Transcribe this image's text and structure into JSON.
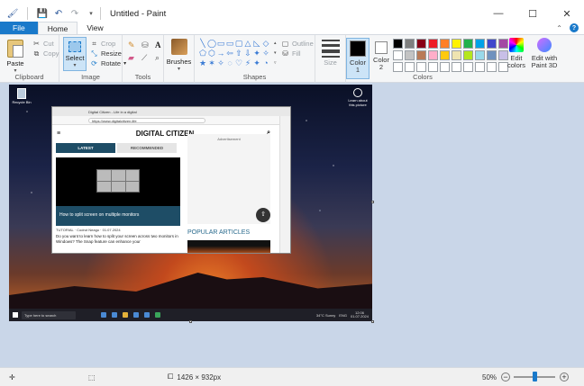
{
  "window": {
    "title": "Untitled - Paint"
  },
  "ribbon_tabs": [
    "File",
    "Home",
    "View"
  ],
  "clipboard": {
    "paste": "Paste",
    "cut": "Cut",
    "copy": "Copy",
    "label": "Clipboard"
  },
  "image": {
    "select": "Select",
    "crop": "Crop",
    "resize": "Resize",
    "rotate": "Rotate",
    "label": "Image"
  },
  "tools": {
    "label": "Tools"
  },
  "brushes": {
    "label": "Brushes"
  },
  "shapes": {
    "outline": "Outline",
    "fill": "Fill",
    "label": "Shapes",
    "glyphs": [
      "╲",
      "◯",
      "▭",
      "▭",
      "▢",
      "△",
      "◺",
      "◇",
      "⬠",
      "⬡",
      "→",
      "⇦",
      "⇧",
      "⇩",
      "✦",
      "✧",
      "★",
      "✶",
      "✧",
      "◌",
      "♡",
      "⚡",
      "✦",
      "◔"
    ]
  },
  "size": {
    "label": "Size"
  },
  "colors": {
    "color1_label": "Color\n1",
    "color2_label": "Color\n2",
    "label": "Colors",
    "color1": "#000000",
    "color2": "#ffffff",
    "palette": [
      "#000000",
      "#7f7f7f",
      "#880015",
      "#ed1c24",
      "#ff7f27",
      "#fff200",
      "#22b14c",
      "#00a2e8",
      "#3f48cc",
      "#a349a4",
      "#ffffff",
      "#c3c3c3",
      "#b97a57",
      "#ffaec9",
      "#ffc90e",
      "#efe4b0",
      "#b5e61d",
      "#99d9ea",
      "#7092be",
      "#c8bfe7",
      "#ffffff",
      "#ffffff",
      "#ffffff",
      "#ffffff",
      "#ffffff",
      "#ffffff",
      "#ffffff",
      "#ffffff",
      "#ffffff",
      "#ffffff"
    ],
    "edit_colors": "Edit\ncolors",
    "edit_3d": "Edit with\nPaint 3D"
  },
  "screenshot": {
    "recycle_bin": "Recycle Bin",
    "learn": "Learn about this picture",
    "browser_tab": "Digital Citizen - Life in a digital",
    "url": "https://www.digitalcitizen.life",
    "site_logo": "DIGITAL CITIZEN",
    "tab_latest": "LATEST",
    "tab_recommended": "RECOMMENDED",
    "card_caption": "How to split screen on multiple monitors",
    "meta_tag": "TUTORIAL",
    "meta_author": "Codrut Neagu",
    "meta_date": "01.07.2024",
    "article_text": "Do you want to learn how to split your screen across two monitors in Windows? The Snap feature can enhance your",
    "advertisement": "Advertisement",
    "popular": "POPULAR ARTICLES",
    "taskbar_search": "Type here to search",
    "weather": "34°C Sunny",
    "lang": "ENG",
    "clock_time": "12:06",
    "clock_date": "01.07.2024"
  },
  "status": {
    "dimensions": "1426 × 932px",
    "zoom": "50%",
    "zoom_fraction": 0.5
  }
}
